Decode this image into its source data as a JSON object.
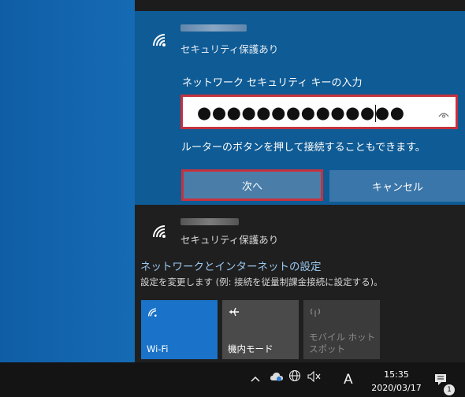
{
  "active_network": {
    "security_status": "セキュリティ保護あり",
    "key_prompt": "ネットワーク セキュリティ キーの入力",
    "password_masked": "●●●●●●●●●●●●●●",
    "router_hint": "ルーターのボタンを押して接続することもできます。",
    "next_button": "次へ",
    "cancel_button": "キャンセル",
    "wifi_icon": "wifi-signal-icon",
    "eye_icon": "reveal-password-icon"
  },
  "other_network": {
    "security_status": "セキュリティ保護あり",
    "wifi_icon": "wifi-signal-icon"
  },
  "settings": {
    "link": "ネットワークとインターネットの設定",
    "description": "設定を変更します (例: 接続を従量制課金接続に設定する)。"
  },
  "quick_actions": [
    {
      "label": "Wi-Fi",
      "icon": "wifi-icon",
      "active": true
    },
    {
      "label": "機内モード",
      "icon": "airplane-icon",
      "active": false
    },
    {
      "label": "モバイル ホットスポット",
      "icon": "hotspot-icon",
      "active": false
    }
  ],
  "taskbar": {
    "time": "15:35",
    "date": "2020/03/17",
    "ime_mode": "A",
    "notification_count": "1",
    "tray_icons": [
      "chevron-up-icon",
      "onedrive-icon",
      "network-globe-icon",
      "volume-muted-icon",
      "notification-icon"
    ]
  },
  "colors": {
    "accent": "#0f5b95",
    "highlight_border": "#c5323e",
    "link": "#9ac8f0",
    "tile_active": "#1a73c8"
  }
}
